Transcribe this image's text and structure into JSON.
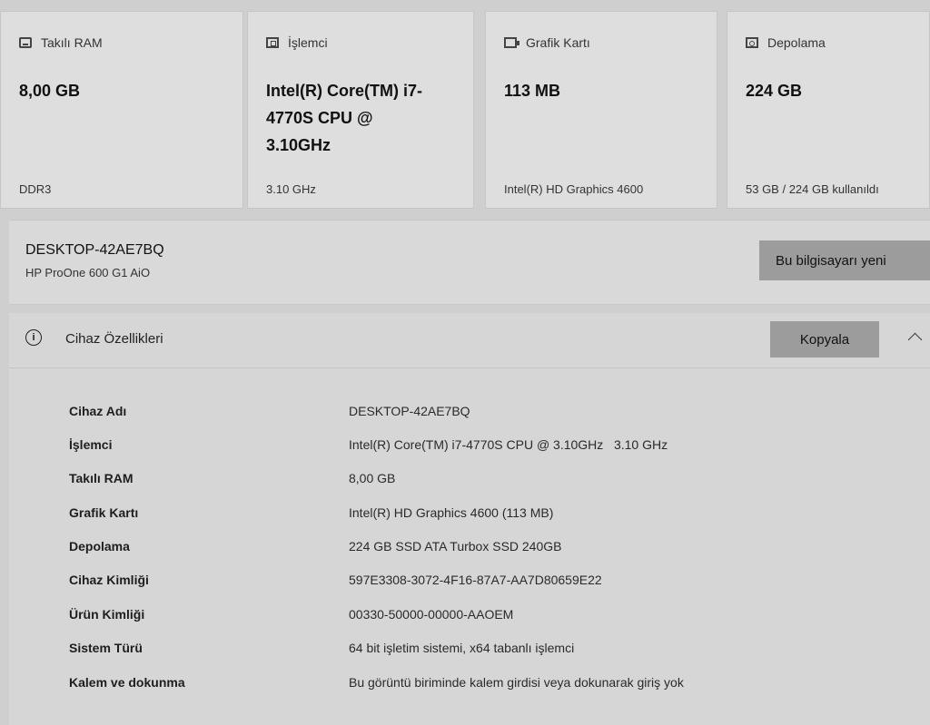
{
  "cards": [
    {
      "label": "Takılı RAM",
      "value": "8,00 GB",
      "sub": "DDR3",
      "icon": "ram-icon"
    },
    {
      "label": "İşlemci",
      "value": "Intel(R) Core(TM) i7-4770S CPU @ 3.10GHz",
      "sub": "3.10 GHz",
      "icon": "processor-icon"
    },
    {
      "label": "Grafik Kartı",
      "value": "113 MB",
      "sub": "Intel(R) HD Graphics 4600",
      "icon": "graphics-card-icon"
    },
    {
      "label": "Depolama",
      "value": "224 GB",
      "sub": "53 GB / 224 GB kullanıldı",
      "icon": "storage-icon"
    }
  ],
  "device": {
    "name": "DESKTOP-42AE7BQ",
    "model": "HP ProOne 600 G1 AiO",
    "rename_label": "Bu bilgisayarı yeni"
  },
  "specs": {
    "title": "Cihaz Özellikleri",
    "info_glyph": "i",
    "copy_label": "Kopyala",
    "rows": [
      {
        "label": "Cihaz Adı",
        "value": "DESKTOP-42AE7BQ"
      },
      {
        "label": "İşlemci",
        "value": "Intel(R) Core(TM) i7-4770S CPU @ 3.10GHz   3.10 GHz"
      },
      {
        "label": "Takılı RAM",
        "value": "8,00 GB"
      },
      {
        "label": "Grafik Kartı",
        "value": "Intel(R) HD Graphics 4600 (113 MB)"
      },
      {
        "label": "Depolama",
        "value": "224 GB SSD ATA Turbox SSD 240GB"
      },
      {
        "label": "Cihaz Kimliği",
        "value": "597E3308-3072-4F16-87A7-AA7D80659E22"
      },
      {
        "label": "Ürün Kimliği",
        "value": "00330-50000-00000-AAOEM"
      },
      {
        "label": "Sistem Türü",
        "value": "64 bit işletim sistemi, x64 tabanlı işlemci"
      },
      {
        "label": "Kalem ve dokunma",
        "value": "Bu görüntü biriminde kalem girdisi veya dokunarak giriş yok"
      }
    ]
  }
}
